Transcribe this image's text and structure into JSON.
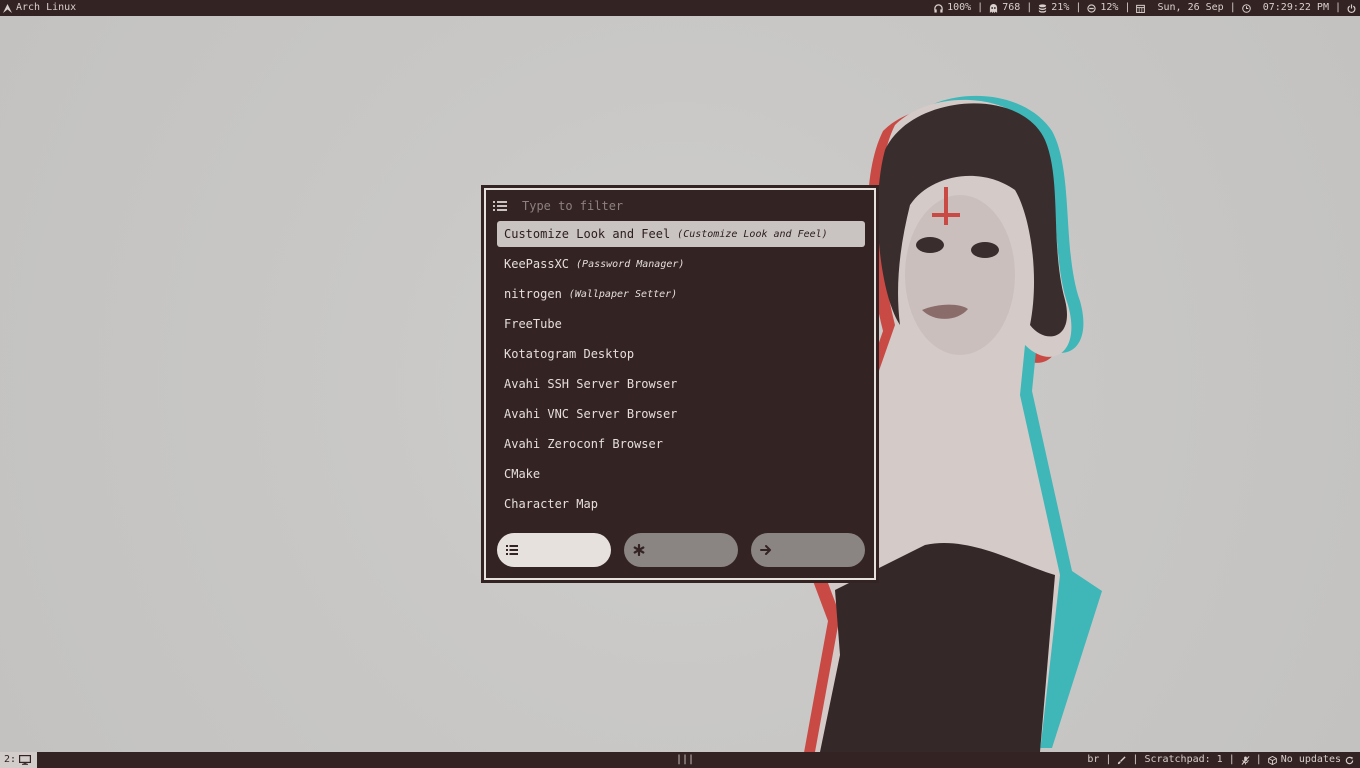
{
  "topbar": {
    "distro_label": "Arch Linux",
    "volume": "100%",
    "temperature": "768",
    "disk": "21%",
    "cpu": "12%",
    "date": "Sun, 26 Sep",
    "time": "07:29:22 PM",
    "separator": "|"
  },
  "launcher": {
    "filter_placeholder": "Type to filter",
    "entries": [
      {
        "name": "Customize Look and Feel",
        "generic": "(Customize Look and Feel)"
      },
      {
        "name": "KeePassXC",
        "generic": "(Password Manager)"
      },
      {
        "name": "nitrogen",
        "generic": "(Wallpaper Setter)"
      },
      {
        "name": "FreeTube",
        "generic": ""
      },
      {
        "name": "Kotatogram Desktop",
        "generic": ""
      },
      {
        "name": "Avahi SSH Server Browser",
        "generic": ""
      },
      {
        "name": "Avahi VNC Server Browser",
        "generic": ""
      },
      {
        "name": "Avahi Zeroconf Browser",
        "generic": ""
      },
      {
        "name": "CMake",
        "generic": ""
      },
      {
        "name": "Character Map",
        "generic": ""
      }
    ],
    "selected_index": 0,
    "modes": [
      {
        "icon": "list-icon",
        "active": true
      },
      {
        "icon": "asterisk-icon",
        "active": false
      },
      {
        "icon": "arrow-right-icon",
        "active": false
      }
    ]
  },
  "bottombar": {
    "workspace": "2:",
    "layout_indicator": "|||",
    "keyboard_layout": "br",
    "scratchpad": "Scratchpad: 1",
    "updates": "No updates"
  },
  "colors": {
    "bar_bg": "#332423",
    "bar_fg": "#d9cfcd",
    "launcher_bg": "#332423",
    "selected_bg": "#c9c3c1",
    "accent_red": "#c94a44",
    "accent_cyan": "#3fb6b8"
  }
}
